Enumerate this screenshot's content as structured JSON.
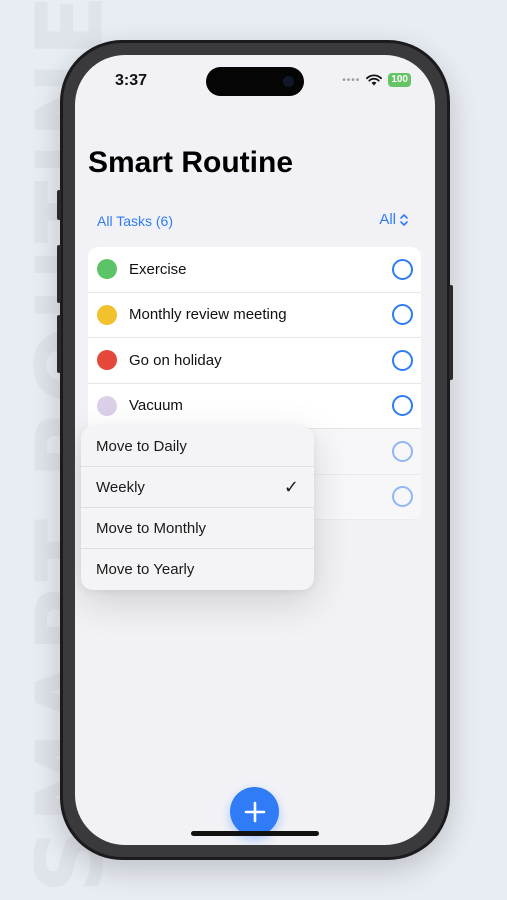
{
  "background": {
    "watermark_text": "SMART ROUTINE"
  },
  "status_bar": {
    "time": "3:37",
    "battery": "100"
  },
  "header": {
    "title": "Smart Routine"
  },
  "filter": {
    "left_label": "All Tasks (6)",
    "right_label": "All"
  },
  "tasks": [
    {
      "label": "Exercise",
      "color": "#5cc466"
    },
    {
      "label": "Monthly review meeting",
      "color": "#f2c12e"
    },
    {
      "label": "Go on holiday",
      "color": "#e5483b"
    },
    {
      "label": "Vacuum",
      "color": "#dcd0e8"
    },
    {
      "label": "",
      "color": "#ffffff"
    },
    {
      "label": "",
      "color": "#ffffff"
    }
  ],
  "context_menu": {
    "items": [
      {
        "label": "Move to Daily",
        "checked": false
      },
      {
        "label": "Weekly",
        "checked": true
      },
      {
        "label": "Move to Monthly",
        "checked": false
      },
      {
        "label": "Move to Yearly",
        "checked": false
      }
    ],
    "check_glyph": "✓"
  },
  "fab": {
    "icon": "plus-icon"
  },
  "colors": {
    "accent": "#2f7cf6",
    "battery": "#65c466"
  }
}
